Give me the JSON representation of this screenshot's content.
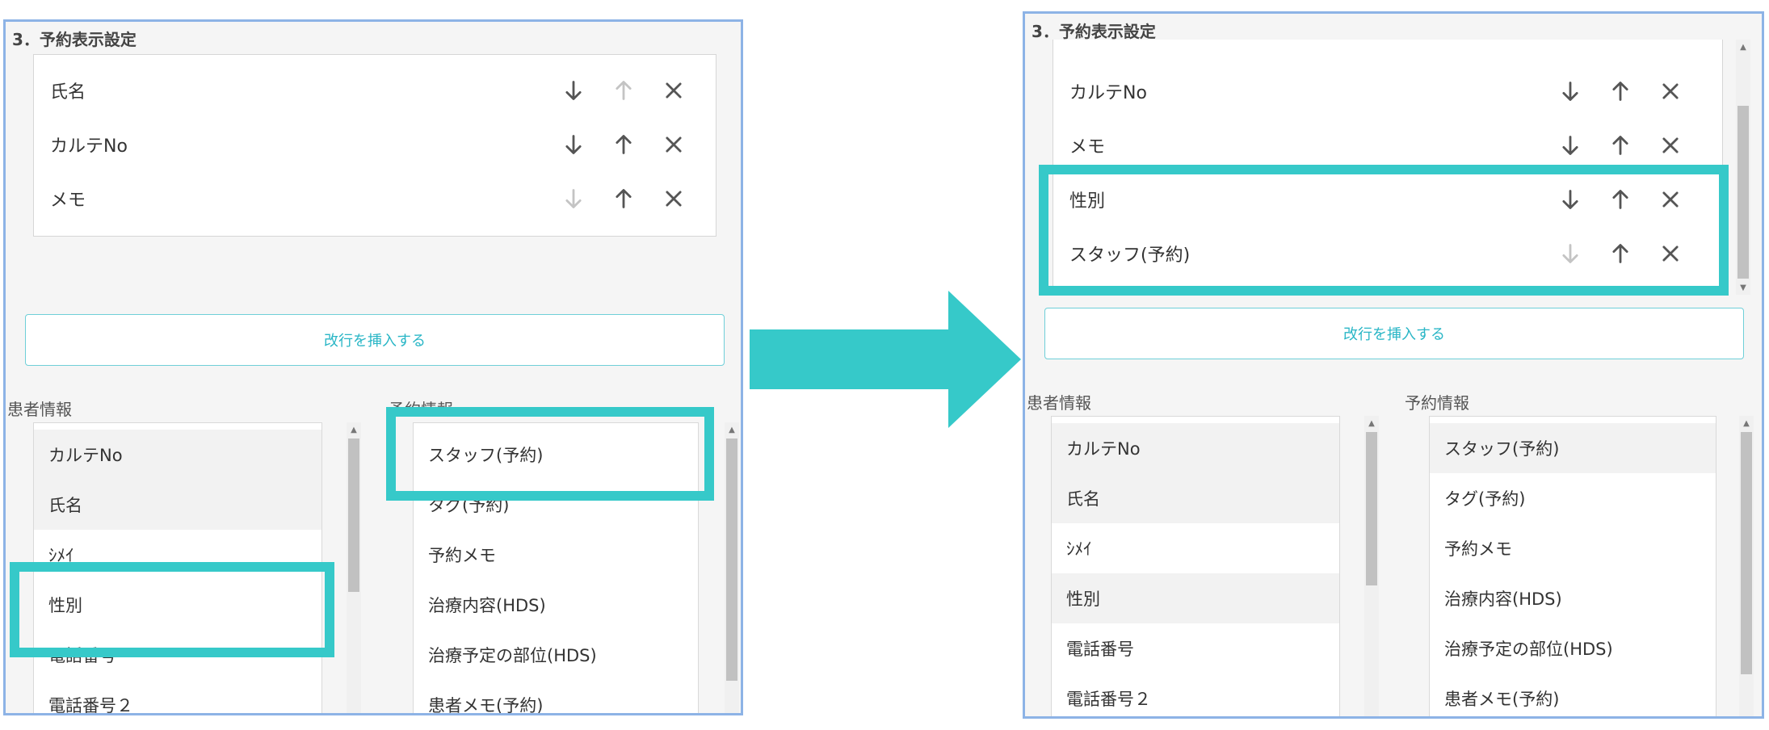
{
  "section_title": "3．予約表示設定",
  "insert_break_label": "改行を挿入する",
  "patient_info_label": "患者情報",
  "reservation_info_label": "予約情報",
  "before": {
    "selected_items": [
      "氏名",
      "カルテNo",
      "メモ"
    ],
    "patient_items": [
      "カルテNo",
      "氏名",
      "ｼﾒｲ",
      "性別",
      "電話番号",
      "電話番号２"
    ],
    "reservation_items": [
      "スタッフ(予約)",
      "タグ(予約)",
      "予約メモ",
      "治療内容(HDS)",
      "治療予定の部位(HDS)",
      "患者メモ(予約)"
    ]
  },
  "after": {
    "selected_items": [
      "カルテNo",
      "メモ",
      "性別",
      "スタッフ(予約)"
    ],
    "patient_items": [
      "カルテNo",
      "氏名",
      "ｼﾒｲ",
      "性別",
      "電話番号",
      "電話番号２"
    ],
    "reservation_items": [
      "スタッフ(予約)",
      "タグ(予約)",
      "予約メモ",
      "治療内容(HDS)",
      "治療予定の部位(HDS)",
      "患者メモ(予約)"
    ]
  },
  "colors": {
    "highlight": "#36c9c9",
    "panel_border": "#8db3e6",
    "accent_text": "#29b6c6"
  },
  "icons": {
    "down": "arrow-down-icon",
    "up": "arrow-up-icon",
    "remove": "close-icon",
    "transition": "right-arrow-icon"
  }
}
